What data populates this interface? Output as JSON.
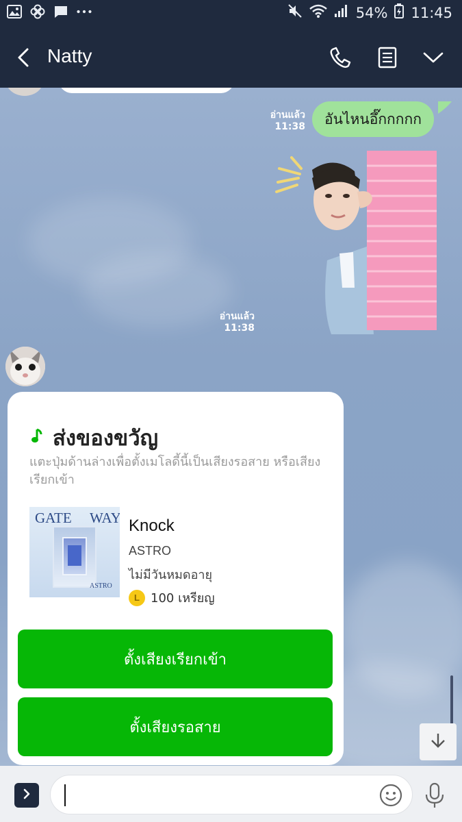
{
  "status_bar": {
    "battery": "54%",
    "time": "11:45"
  },
  "header": {
    "title": "Natty"
  },
  "messages": {
    "green_text": "อันไหนอึ๊กกกกก",
    "read_label_1": "อ่านแล้ว",
    "time_1": "11:38",
    "read_label_2": "อ่านแล้ว",
    "time_2": "11:38"
  },
  "gift": {
    "title": "ส่งของขวัญ",
    "description": "แตะปุ่มด้านล่างเพื่อตั้งเมโลดี้นี้เป็นเสียงรอสาย หรือเสียงเรียกเข้า",
    "album_text_1": "GATE",
    "album_text_2": "WAY",
    "album_artist": "ASTRO",
    "song": "Knock",
    "artist": "ASTRO",
    "expiry": "ไม่มีวันหมดอายุ",
    "coin_symbol": "L",
    "price": "100 เหรียญ",
    "button_ringtone": "ตั้งเสียงเรียกเข้า",
    "button_ringback": "ตั้งเสียงรอสาย"
  },
  "icons": {
    "back": "back-arrow-icon",
    "call": "phone-icon",
    "notes": "notes-icon",
    "menu": "chevron-down-icon",
    "scroll_down": "arrow-down-icon",
    "emoji": "emoji-icon",
    "mic": "mic-icon"
  },
  "colors": {
    "header_bg": "#1f2a3e",
    "sent_bubble": "#a0e29b",
    "action_button": "#06b706"
  }
}
